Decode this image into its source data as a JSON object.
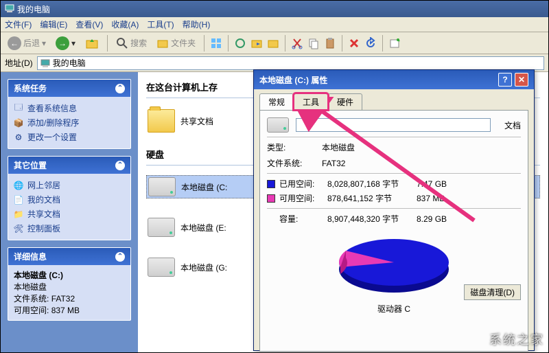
{
  "window": {
    "title": "我的电脑"
  },
  "menu": {
    "file": "文件(F)",
    "edit": "编辑(E)",
    "view": "查看(V)",
    "favorites": "收藏(A)",
    "tools": "工具(T)",
    "help": "帮助(H)"
  },
  "toolbar": {
    "back": "后退",
    "search": "搜索",
    "folders": "文件夹"
  },
  "address": {
    "label": "地址(D)",
    "value": "我的电脑"
  },
  "sidebar": {
    "tasks": {
      "title": "系统任务",
      "items": [
        "查看系统信息",
        "添加/删除程序",
        "更改一个设置"
      ]
    },
    "other": {
      "title": "其它位置",
      "items": [
        "网上邻居",
        "我的文档",
        "共享文档",
        "控制面板"
      ]
    },
    "details": {
      "title": "详细信息",
      "name": "本地磁盘 (C:)",
      "type": "本地磁盘",
      "fs_label": "文件系统:",
      "fs": "FAT32",
      "free_label": "可用空间:",
      "free": "837 MB"
    }
  },
  "main": {
    "stored_header": "在这台计算机上存",
    "shared": "共享文档",
    "docs_suffix": "文档",
    "disks_header": "硬盘",
    "drives": [
      "本地磁盘 (C:",
      "本地磁盘 (E:",
      "本地磁盘 (G:"
    ]
  },
  "dialog": {
    "title": "本地磁盘 (C:) 属性",
    "tabs": {
      "general": "常规",
      "tools": "工具",
      "hardware": "硬件"
    },
    "type_label": "类型:",
    "type": "本地磁盘",
    "fs_label": "文件系统:",
    "fs": "FAT32",
    "used_label": "已用空间:",
    "used_bytes": "8,028,807,168 字节",
    "used_h": "7.47 GB",
    "free_label": "可用空间:",
    "free_bytes": "878,641,152 字节",
    "free_h": "837 MB",
    "cap_label": "容量:",
    "cap_bytes": "8,907,448,320 字节",
    "cap_h": "8.29 GB",
    "drive_caption": "驱动器 C",
    "cleanup": "磁盘清理(D)"
  },
  "chart_data": {
    "type": "pie",
    "title": "驱动器 C",
    "series": [
      {
        "name": "已用空间",
        "value": 8028807168,
        "human": "7.47 GB",
        "color": "#1818d8"
      },
      {
        "name": "可用空间",
        "value": 878641152,
        "human": "837 MB",
        "color": "#e83ab5"
      }
    ],
    "total": {
      "value": 8907448320,
      "human": "8.29 GB"
    }
  },
  "watermark": "系统之家"
}
